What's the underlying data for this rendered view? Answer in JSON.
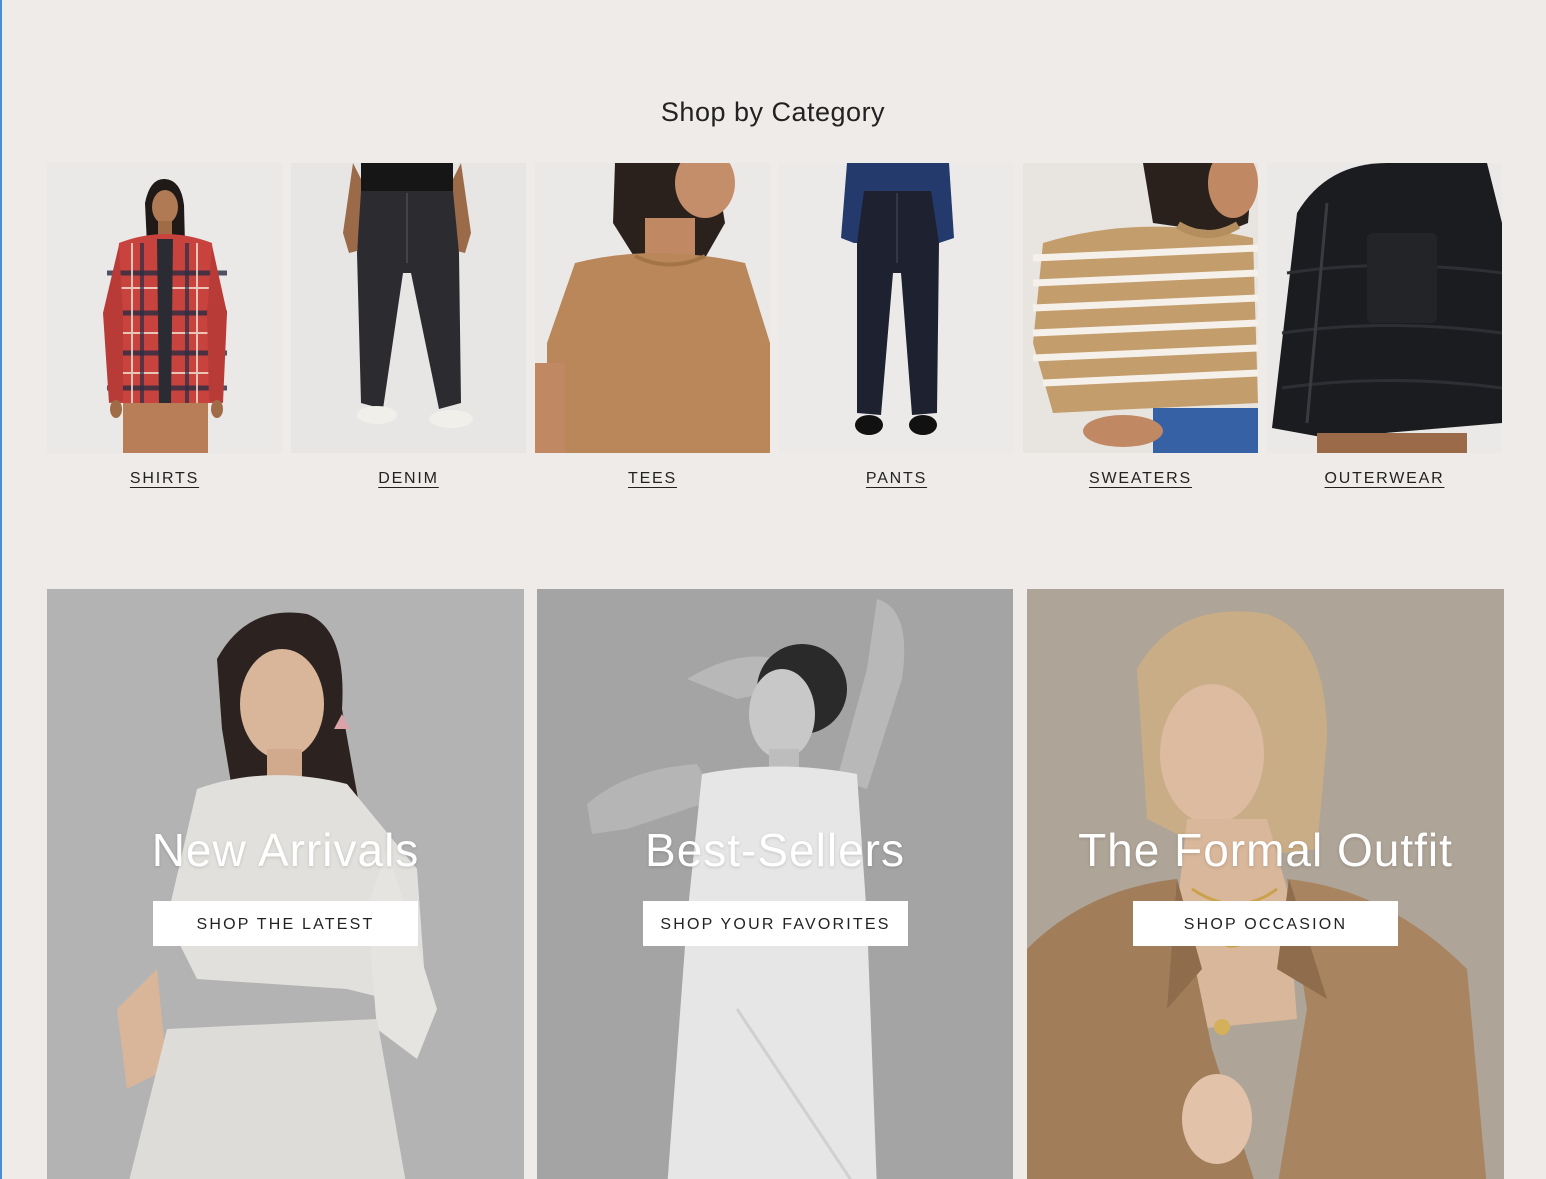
{
  "section": {
    "title": "Shop by Category"
  },
  "categories": [
    {
      "label": "SHIRTS",
      "image": "plaid-shirt-photo"
    },
    {
      "label": "DENIM",
      "image": "black-jeans-photo"
    },
    {
      "label": "TEES",
      "image": "tan-tee-photo"
    },
    {
      "label": "PANTS",
      "image": "navy-trousers-photo"
    },
    {
      "label": "SWEATERS",
      "image": "striped-sweater-photo"
    },
    {
      "label": "OUTERWEAR",
      "image": "black-puffer-photo"
    }
  ],
  "promos": [
    {
      "title": "New Arrivals",
      "button": "SHOP THE LATEST",
      "image": "white-outfit-photo"
    },
    {
      "title": "Best-Sellers",
      "button": "SHOP YOUR FAVORITES",
      "image": "white-jumpsuit-bw-photo"
    },
    {
      "title": "The Formal Outfit",
      "button": "SHOP OCCASION",
      "image": "camel-blazer-photo"
    }
  ],
  "colors": {
    "page_background": "#eeebe8",
    "text": "#222222",
    "button_background": "#ffffff"
  }
}
